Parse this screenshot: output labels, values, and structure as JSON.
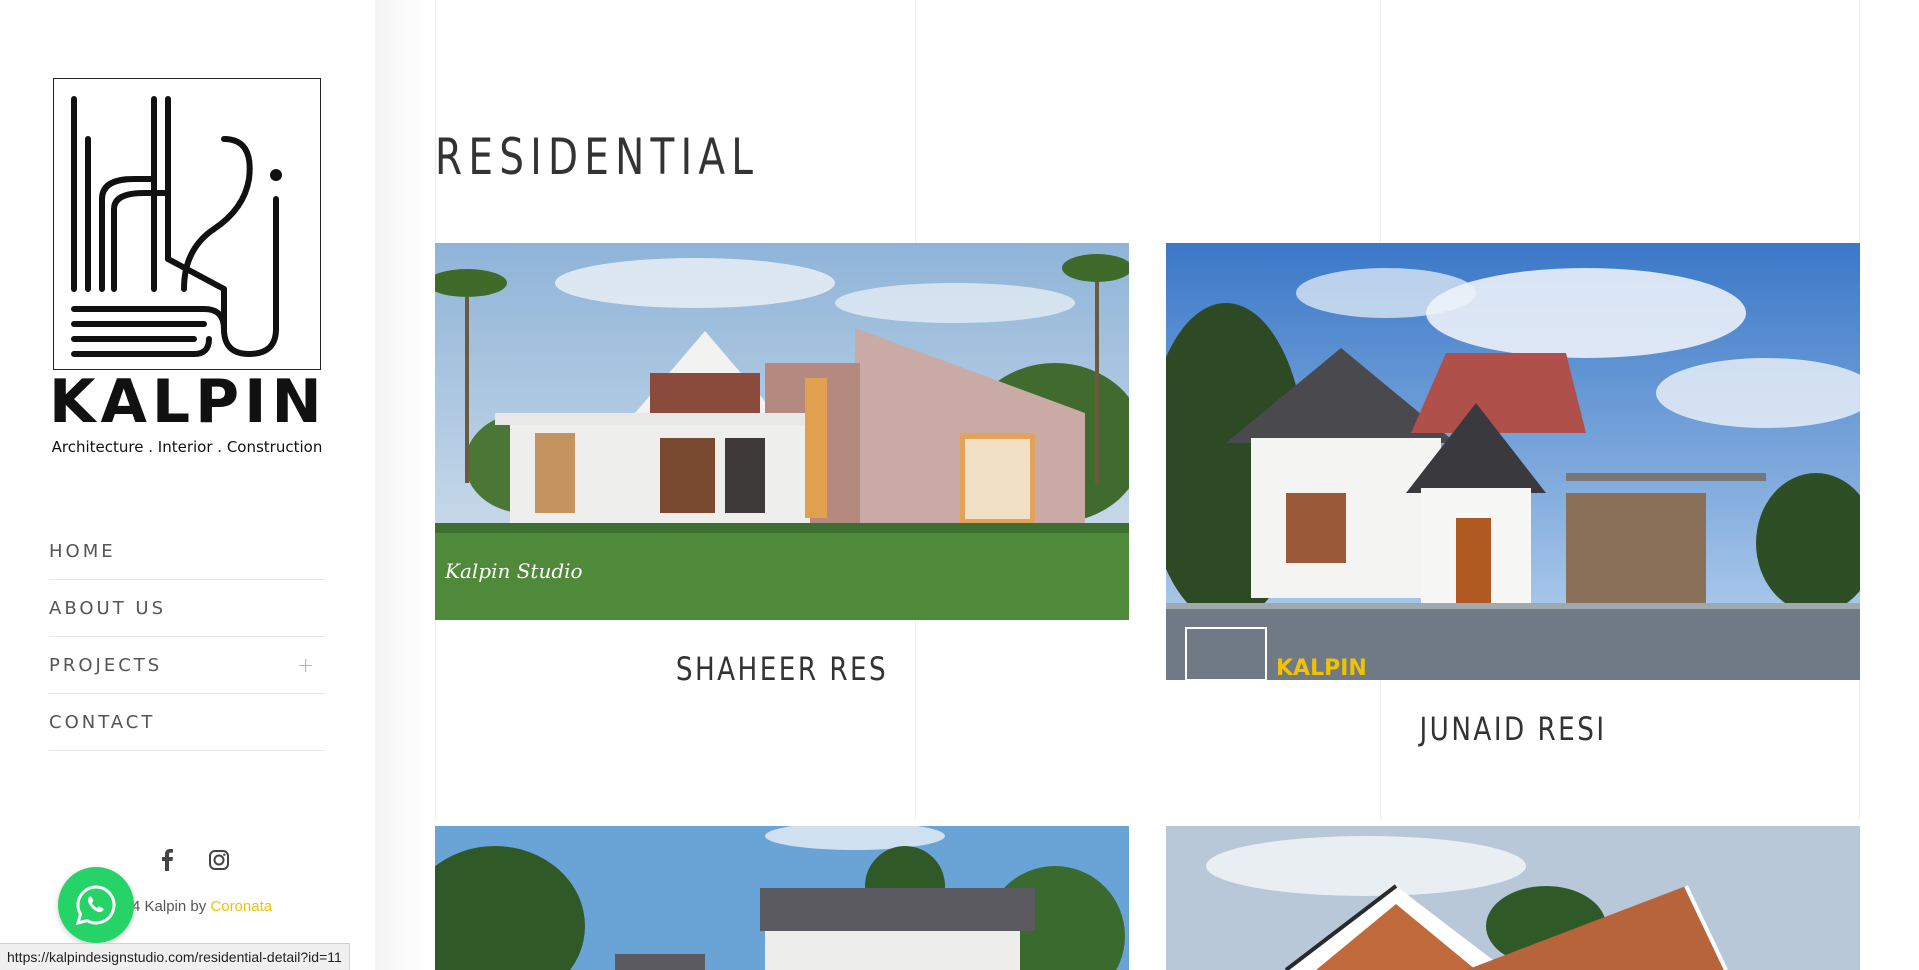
{
  "brand": {
    "name": "KALPIN",
    "tagline": "Architecture .  Interior . Construction"
  },
  "nav": {
    "items": [
      {
        "label": "HOME"
      },
      {
        "label": "ABOUT US"
      },
      {
        "label": "PROJECTS"
      },
      {
        "label": "CONTACT"
      }
    ]
  },
  "footer": {
    "copyright_prefix": "4  Kalpin by ",
    "copyright_brand": "Coronata"
  },
  "status_url": "https://kalpindesignstudio.com/residential-detail?id=11",
  "page": {
    "title": "RESIDENTIAL"
  },
  "projects": [
    {
      "title": "SHAHEER RES",
      "watermark": "Kalpin Studio"
    },
    {
      "title": "JUNAID RESI",
      "watermark": "KALPIN"
    },
    {
      "title": ""
    },
    {
      "title": ""
    }
  ],
  "colors": {
    "accent": "#f2c200",
    "whatsapp": "#25d366"
  }
}
